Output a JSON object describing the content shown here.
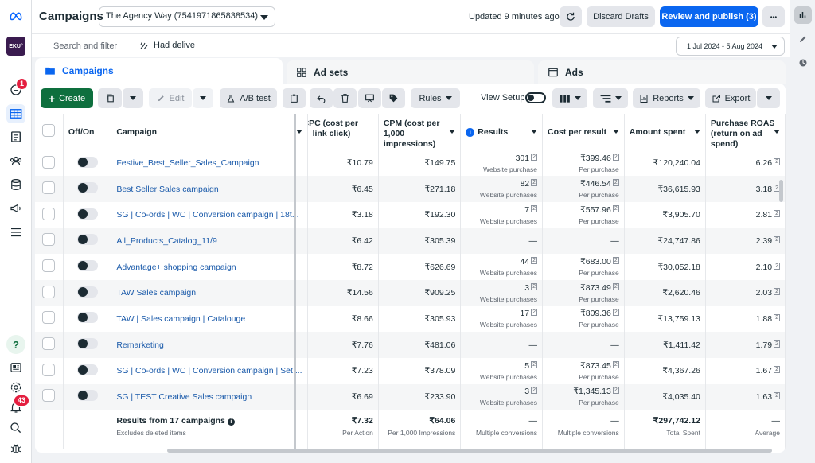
{
  "header": {
    "title": "Campaigns",
    "account": "The Agency Way (7541971865838534)",
    "updated": "Updated 9 minutes ago",
    "discard": "Discard Drafts",
    "review": "Review and publish (3)",
    "more": "•••"
  },
  "search": {
    "placeholder": "Search and filter",
    "chip": "Had delive"
  },
  "daterange": "1 Jul 2024 - 5 Aug 2024",
  "rail": {
    "avatar_text": "EKU°",
    "notif_badge": "1",
    "bell_badge": "43"
  },
  "tabs": {
    "campaigns": "Campaigns",
    "adsets": "Ad sets",
    "ads": "Ads"
  },
  "toolbar": {
    "create": "Create",
    "edit": "Edit",
    "abtest": "A/B test",
    "rules": "Rules",
    "view_setup": "View Setup",
    "reports": "Reports",
    "export": "Export"
  },
  "columns": {
    "onoff": "Off/On",
    "campaign": "Campaign",
    "cpc": "CPC (cost per link click)",
    "cpm": "CPM (cost per 1,000 impressions)",
    "results": "Results",
    "cost_per_result": "Cost per result",
    "amount_spent": "Amount spent",
    "roas": "Purchase ROAS (return on ad spend)"
  },
  "rows": [
    {
      "name": "Festive_Best_Seller_Sales_Campaign",
      "cpc": "₹10.79",
      "cpm": "₹149.75",
      "results": "301",
      "results_sub": "Website purchase",
      "cpr": "₹399.46",
      "cpr_sub": "Per purchase",
      "spent": "₹120,240.04",
      "roas": "6.26"
    },
    {
      "name": "Best Seller Sales campaign",
      "cpc": "₹6.45",
      "cpm": "₹271.18",
      "results": "82",
      "results_sub": "Website purchases",
      "cpr": "₹446.54",
      "cpr_sub": "Per purchase",
      "spent": "₹36,615.93",
      "roas": "3.18"
    },
    {
      "name": "SG | Co-ords | WC | Conversion campaign | 18t...",
      "cpc": "₹3.18",
      "cpm": "₹192.30",
      "results": "7",
      "results_sub": "Website purchases",
      "cpr": "₹557.96",
      "cpr_sub": "Per purchase",
      "spent": "₹3,905.70",
      "roas": "2.81"
    },
    {
      "name": "All_Products_Catalog_11/9",
      "cpc": "₹6.42",
      "cpm": "₹305.39",
      "results": "—",
      "results_sub": "",
      "cpr": "—",
      "cpr_sub": "",
      "spent": "₹24,747.86",
      "roas": "2.39"
    },
    {
      "name": "Advantage+ shopping campaign",
      "cpc": "₹8.72",
      "cpm": "₹626.69",
      "results": "44",
      "results_sub": "Website purchases",
      "cpr": "₹683.00",
      "cpr_sub": "Per purchase",
      "spent": "₹30,052.18",
      "roas": "2.10"
    },
    {
      "name": "TAW Sales campaign",
      "cpc": "₹14.56",
      "cpm": "₹909.25",
      "results": "3",
      "results_sub": "Website purchases",
      "cpr": "₹873.49",
      "cpr_sub": "Per purchase",
      "spent": "₹2,620.46",
      "roas": "2.03"
    },
    {
      "name": "TAW | Sales campaign | Catalouge",
      "cpc": "₹8.66",
      "cpm": "₹305.93",
      "results": "17",
      "results_sub": "Website purchases",
      "cpr": "₹809.36",
      "cpr_sub": "Per purchase",
      "spent": "₹13,759.13",
      "roas": "1.88"
    },
    {
      "name": "Remarketing",
      "cpc": "₹7.76",
      "cpm": "₹481.06",
      "results": "—",
      "results_sub": "",
      "cpr": "—",
      "cpr_sub": "",
      "spent": "₹1,411.42",
      "roas": "1.79"
    },
    {
      "name": "SG | Co-ords | WC | Conversion campaign | Set ...",
      "cpc": "₹7.23",
      "cpm": "₹378.09",
      "results": "5",
      "results_sub": "Website purchases",
      "cpr": "₹873.45",
      "cpr_sub": "Per purchase",
      "spent": "₹4,367.26",
      "roas": "1.67"
    },
    {
      "name": "SG | TEST Creative Sales campaign",
      "cpc": "₹6.69",
      "cpm": "₹233.90",
      "results": "3",
      "results_sub": "Website purchases",
      "cpr": "₹1,345.13",
      "cpr_sub": "Per purchase",
      "spent": "₹4,035.40",
      "roas": "1.63"
    }
  ],
  "footer": {
    "title": "Results from 17 campaigns",
    "subtitle": "Excludes deleted items",
    "cpc": "₹7.32",
    "cpc_sub": "Per Action",
    "cpm": "₹64.06",
    "cpm_sub": "Per 1,000 Impressions",
    "results": "—",
    "results_sub": "Multiple conversions",
    "cpr": "—",
    "cpr_sub": "Multiple conversions",
    "spent": "₹297,742.12",
    "spent_sub": "Total Spent",
    "roas": "—",
    "roas_sub": "Average"
  },
  "colors": {
    "primary": "#0a66f0",
    "create_green": "#0e6f3e",
    "link": "#1a5aaa",
    "badge": "#e41e3f"
  }
}
